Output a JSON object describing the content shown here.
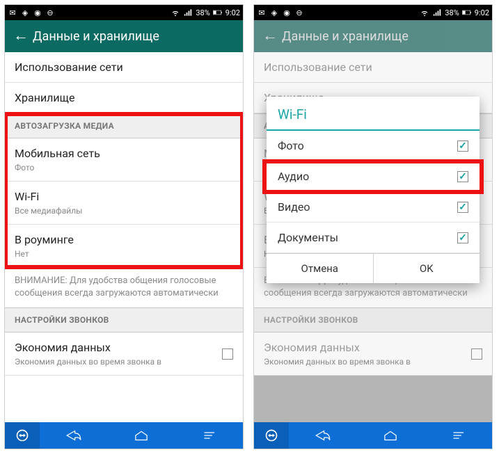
{
  "status": {
    "battery_pct": "38%",
    "time": "9:02"
  },
  "appbar": {
    "title": "Данные и хранилище"
  },
  "left": {
    "rows": {
      "network_usage": "Использование сети",
      "storage": "Хранилище"
    },
    "section_auto": "АВТОЗАГРУЗКА МЕДИА",
    "mobile": {
      "title": "Мобильная сеть",
      "sub": "Фото"
    },
    "wifi": {
      "title": "Wi-Fi",
      "sub": "Все медиафайлы"
    },
    "roam": {
      "title": "В роуминге",
      "sub": "Нет"
    },
    "hint": "ВНИМАНИЕ: Для удобства общения голосовые сообщения всегда загружаются автоматически",
    "section_calls": "НАСТРОЙКИ ЗВОНКОВ",
    "low_data": {
      "title": "Экономия данных",
      "sub": "Экономия данных во время звонка в"
    }
  },
  "dialog": {
    "title": "Wi-Fi",
    "items": {
      "photo": "Фото",
      "audio": "Аудио",
      "video": "Видео",
      "docs": "Документы"
    },
    "cancel": "Отмена",
    "ok": "OK"
  }
}
